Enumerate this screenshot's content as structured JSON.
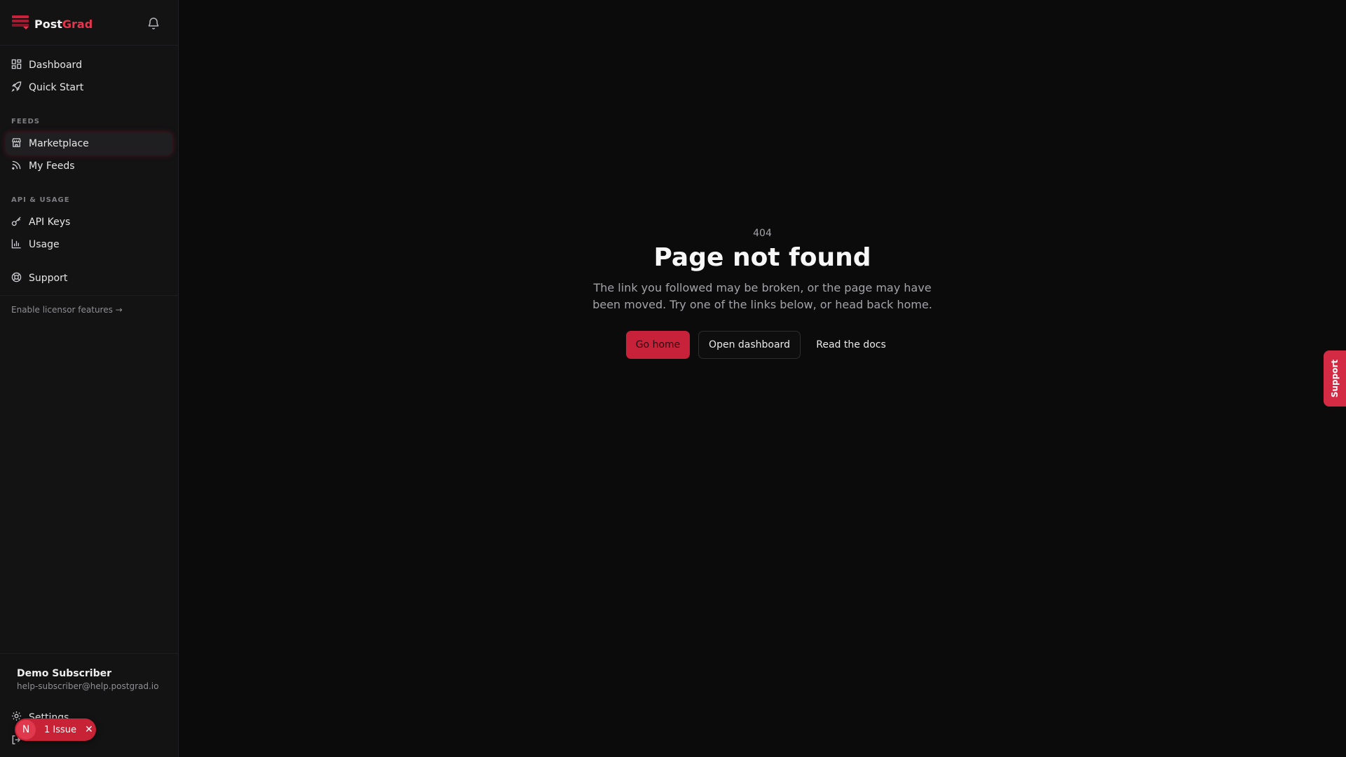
{
  "brand": {
    "name_part1": "Post",
    "name_part2": "Grad",
    "accent_color": "#e2364f"
  },
  "sidebar": {
    "top_items": [
      {
        "label": "Dashboard",
        "icon": "dashboard-icon"
      },
      {
        "label": "Quick Start",
        "icon": "rocket-icon"
      }
    ],
    "sections": [
      {
        "label": "FEEDS",
        "items": [
          {
            "label": "Marketplace",
            "icon": "store-icon",
            "active": true
          },
          {
            "label": "My Feeds",
            "icon": "rss-icon"
          }
        ]
      },
      {
        "label": "API & USAGE",
        "items": [
          {
            "label": "API Keys",
            "icon": "key-icon"
          },
          {
            "label": "Usage",
            "icon": "bar-chart-icon"
          }
        ]
      }
    ],
    "support": {
      "label": "Support",
      "icon": "lifebuoy-icon"
    },
    "licensor_link": "Enable licensor features →",
    "user": {
      "name": "Demo Subscriber",
      "email": "help-subscriber@help.postgrad.io"
    },
    "settings_label": "Settings"
  },
  "issue_badge": {
    "avatar_letter": "N",
    "label": "1 Issue",
    "close": "✕"
  },
  "error_page": {
    "code": "404",
    "title": "Page not found",
    "description": "The link you followed may be broken, or the page may have been moved. Try one of the links below, or head back home.",
    "buttons": {
      "home": "Go home",
      "dashboard": "Open dashboard",
      "docs": "Read the docs"
    }
  },
  "support_tab": {
    "label": "Support",
    "color": "#d42b45"
  }
}
